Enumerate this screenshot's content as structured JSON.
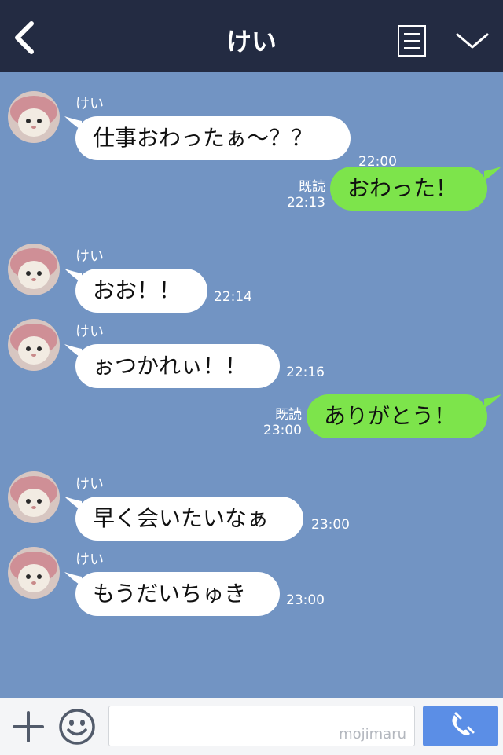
{
  "header": {
    "title": "けい",
    "back_icon": "chevron-left-icon",
    "menu_icon": "note-list-icon",
    "collapse_icon": "chevron-down-icon"
  },
  "messages": [
    {
      "sender": "けい",
      "text": "仕事おわったぁ〜？？",
      "time": "22:00",
      "side": "left"
    },
    {
      "text": "おわった！",
      "time": "22:13",
      "read": "既読",
      "side": "right"
    },
    {
      "sender": "けい",
      "text": "おお！！",
      "time": "22:14",
      "side": "left"
    },
    {
      "sender": "けい",
      "text": "ぉつかれぃ！！",
      "time": "22:16",
      "side": "left"
    },
    {
      "text": "ありがとう！",
      "time": "23:00",
      "read": "既読",
      "side": "right"
    },
    {
      "sender": "けい",
      "text": "早く会いたいなぁ",
      "time": "23:00",
      "side": "left"
    },
    {
      "sender": "けい",
      "text": "もうだいちゅき",
      "time": "23:00",
      "side": "left"
    }
  ],
  "footer": {
    "watermark": "mojimaru",
    "plus_icon": "plus-icon",
    "emoji_icon": "smiley-icon",
    "call_icon": "phone-icon"
  },
  "colors": {
    "header_bg": "#232b42",
    "chat_bg": "#7294c3",
    "bubble_self": "#7de44b",
    "bubble_other": "#ffffff",
    "call_button": "#5b8ee6"
  }
}
